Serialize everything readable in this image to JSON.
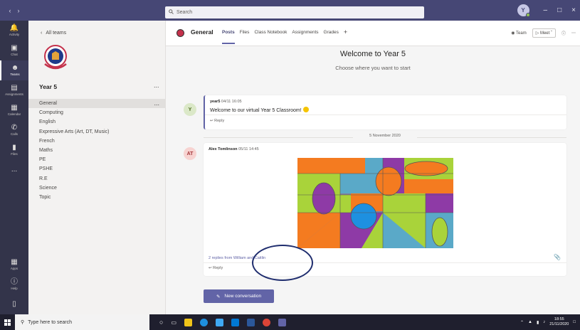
{
  "titlebar": {
    "search_placeholder": "Search",
    "avatar_initial": "Y"
  },
  "rail": {
    "items": [
      {
        "label": "Activity",
        "icon": "bell-icon"
      },
      {
        "label": "Chat",
        "icon": "chat-icon"
      },
      {
        "label": "Teams",
        "icon": "teams-icon"
      },
      {
        "label": "Assignments",
        "icon": "assignments-icon"
      },
      {
        "label": "Calendar",
        "icon": "calendar-icon"
      },
      {
        "label": "Calls",
        "icon": "phone-icon"
      },
      {
        "label": "Files",
        "icon": "file-icon"
      }
    ],
    "more": "...",
    "apps": "Apps",
    "help": "Help"
  },
  "teampanel": {
    "back_label": "All teams",
    "team_name": "Year 5",
    "team_more": "...",
    "channels": [
      "General",
      "Computing",
      "English",
      "Expressive Arts (Art, DT, Music)",
      "French",
      "Maths",
      "PE",
      "PSHE",
      "R.E",
      "Science",
      "Topic"
    ],
    "channel_more": "..."
  },
  "main": {
    "channel_title": "General",
    "tabs": [
      "Posts",
      "Files",
      "Class Notebook",
      "Assignments",
      "Grades"
    ],
    "tab_add": "+",
    "team_btn": "Team",
    "meet_btn": "Meet",
    "welcome_title": "Welcome to Year 5",
    "welcome_sub": "Choose where you want to start",
    "post1": {
      "avatar": "Y",
      "author": "year5",
      "time": "04/11 16:05",
      "body": "Welcome to our virtual Year 5 Classroom!",
      "reply": "Reply"
    },
    "date_divider": "5 November 2020",
    "post2": {
      "avatar": "AT",
      "author": "Alex Tomlinson",
      "time": "05/11 14:45",
      "replies_from": "2 replies from William and Caitlin",
      "reply": "Reply"
    },
    "new_conversation": "New conversation"
  },
  "taskbar": {
    "search_placeholder": "Type here to search",
    "time": "18:55",
    "date": "21/11/2020"
  },
  "colors": {
    "titlebar": "#464775",
    "rail": "#33344a",
    "accent": "#6264a7",
    "annotation": "#1f2d6e"
  }
}
